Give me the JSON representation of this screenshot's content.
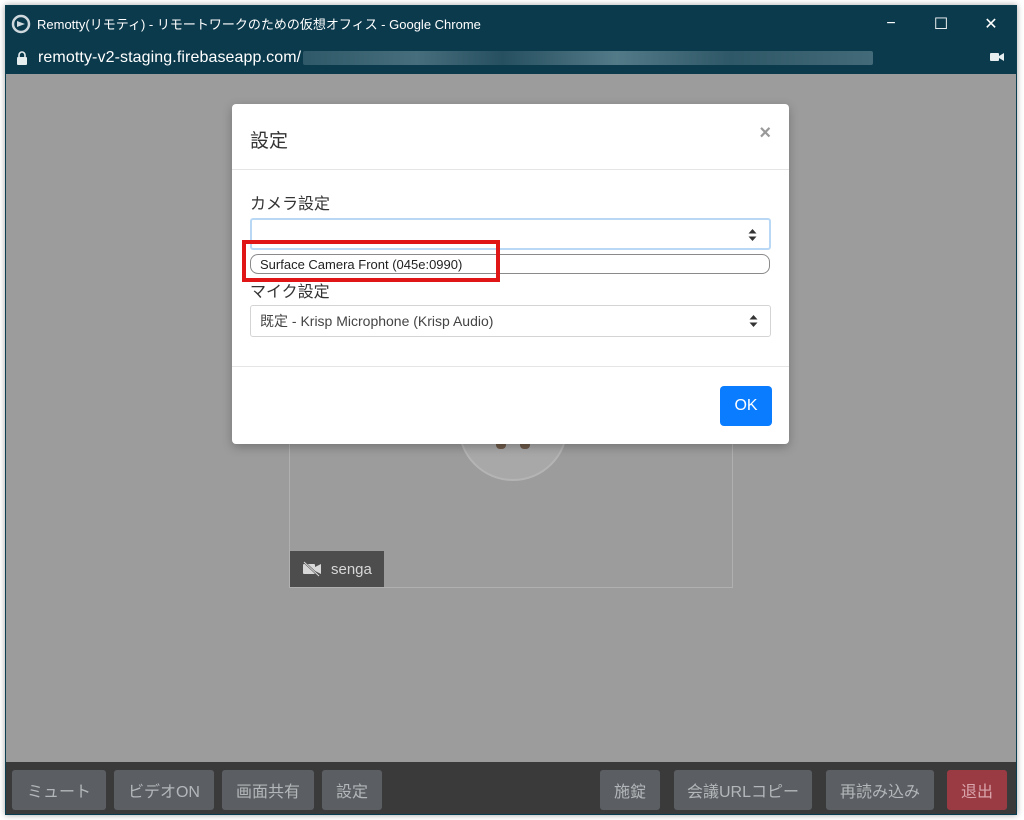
{
  "window": {
    "title": "Remotty(リモティ) - リモートワークのための仮想オフィス - Google Chrome",
    "url": "remotty-v2-staging.firebaseapp.com/",
    "controls": {
      "minimize": "−",
      "maximize": "☐",
      "close": "✕"
    }
  },
  "video": {
    "user_name": "senga"
  },
  "modal": {
    "title": "設定",
    "close_glyph": "×",
    "camera_label": "カメラ設定",
    "camera_value": "",
    "camera_option": "Surface Camera Front (045e:0990)",
    "mic_label": "マイク設定",
    "mic_value": "既定 - Krisp Microphone (Krisp Audio)",
    "ok_label": "OK"
  },
  "toolbar": {
    "mute": "ミュート",
    "video_on": "ビデオON",
    "screen_share": "画面共有",
    "settings": "設定",
    "lock": "施錠",
    "copy_url": "会議URLコピー",
    "reload": "再読み込み",
    "leave": "退出"
  },
  "colors": {
    "titlebar": "#0b3a4c",
    "ok_button": "#0a7cff",
    "highlight": "#e01616",
    "leave_button": "#9a3b44"
  }
}
